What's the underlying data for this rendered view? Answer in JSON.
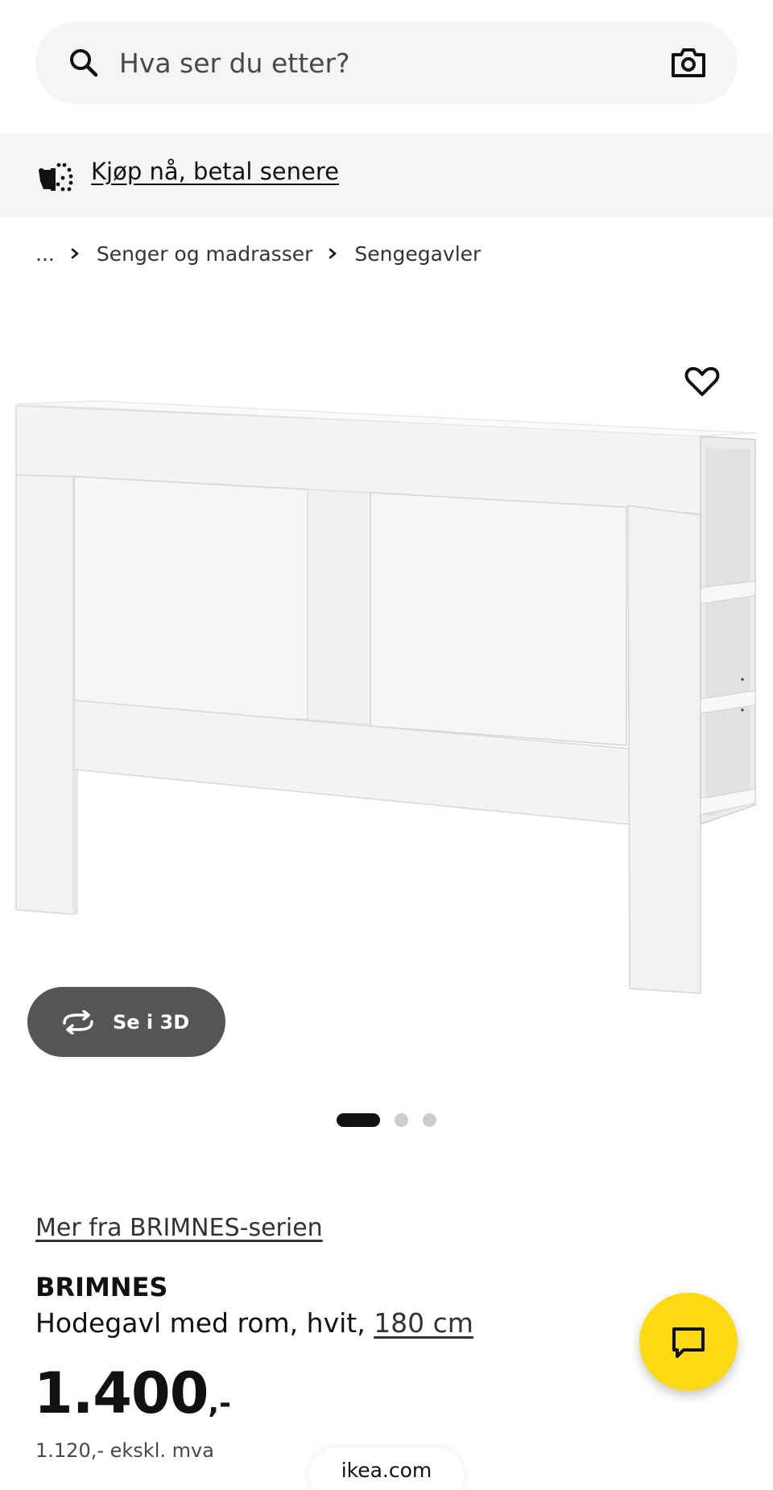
{
  "search": {
    "placeholder": "Hva ser du etter?",
    "icon": "search-icon",
    "camera_icon": "camera-icon"
  },
  "promo": {
    "label": "Kjøp nå, betal senere",
    "icon": "pay-later-icon"
  },
  "breadcrumb": {
    "ellipsis": "...",
    "items": [
      "Senger og madrasser",
      "Sengegavler"
    ]
  },
  "gallery": {
    "image_alt": "BRIMNES Hodegavl med rom, hvit",
    "favorite_icon": "heart-icon",
    "view3d_label": "Se i 3D",
    "slide_count": 3,
    "active_slide": 1
  },
  "product": {
    "series_link": "Mer fra BRIMNES-serien",
    "name": "BRIMNES",
    "description": "Hodegavl med rom, hvit, ",
    "size": "180 cm",
    "price": "1.400",
    "price_suffix": ",-",
    "price_ex_vat": "1.120,- ekskl. mva"
  },
  "chat": {
    "icon": "chat-icon"
  },
  "browser": {
    "url": "ikea.com"
  },
  "colors": {
    "accent_yellow": "#fbd914",
    "surface_grey": "#f5f5f5",
    "button_dark": "#555555"
  }
}
